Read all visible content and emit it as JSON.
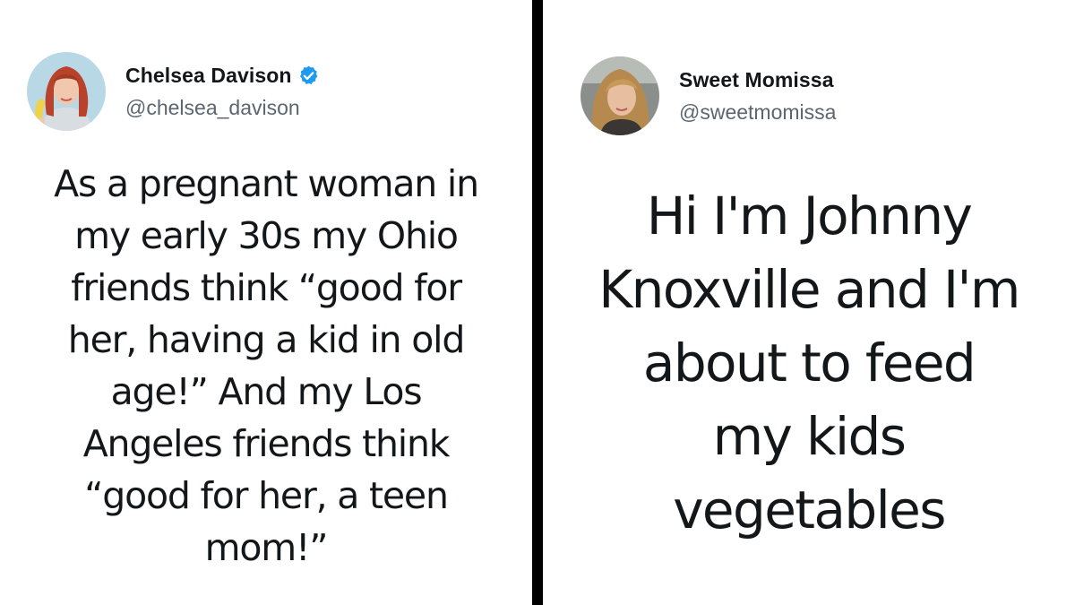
{
  "tweets": [
    {
      "author": {
        "name": "Chelsea Davison",
        "handle": "@chelsea_davison",
        "verified": true,
        "avatar_icon": "woman-red-hair-holding-banana"
      },
      "text": "As a pregnant woman in\nmy early 30s my Ohio\nfriends think “good for\nher, having a kid in old\nage!” And my Los\nAngeles friends think\n“good for her, a teen\nmom!”"
    },
    {
      "author": {
        "name": "Sweet Momissa",
        "handle": "@sweetmomissa",
        "verified": false,
        "avatar_icon": "woman-blonde-hair-selfie"
      },
      "text": "Hi I'm Johnny\nKnoxville and I'm\nabout to feed\nmy kids\nvegetables"
    }
  ],
  "colors": {
    "divider": "#000000",
    "text": "#14171a",
    "handle": "#5b6670",
    "verified_badge": "#1d9bf0"
  }
}
